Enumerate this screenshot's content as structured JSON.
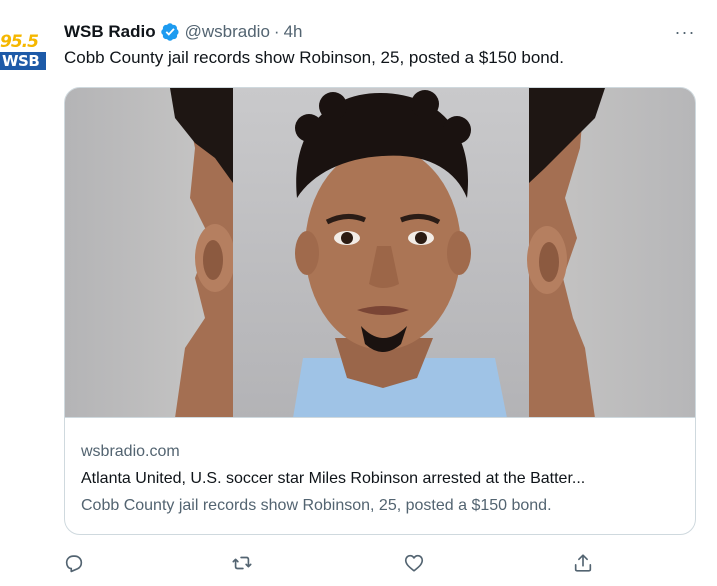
{
  "tweet": {
    "avatar": {
      "number": "95.5",
      "call_letters": "WSB"
    },
    "display_name": "WSB Radio",
    "handle": "@wsbradio",
    "separator": "·",
    "time": "4h",
    "more_icon": "···",
    "text": "Cobb County jail records show Robinson, 25, posted a $150 bond."
  },
  "card": {
    "domain": "wsbradio.com",
    "title": "Atlanta United, U.S. soccer star Miles Robinson arrested at the Batter...",
    "description": "Cobb County jail records show Robinson, 25, posted a $150 bond."
  },
  "icons": {
    "verified": "verified-badge-icon",
    "reply": "reply-icon",
    "retweet": "retweet-icon",
    "like": "heart-icon",
    "share": "share-icon"
  },
  "colors": {
    "verified_blue": "#1d9bf0",
    "secondary_text": "#536471",
    "border": "#cfd9de"
  }
}
